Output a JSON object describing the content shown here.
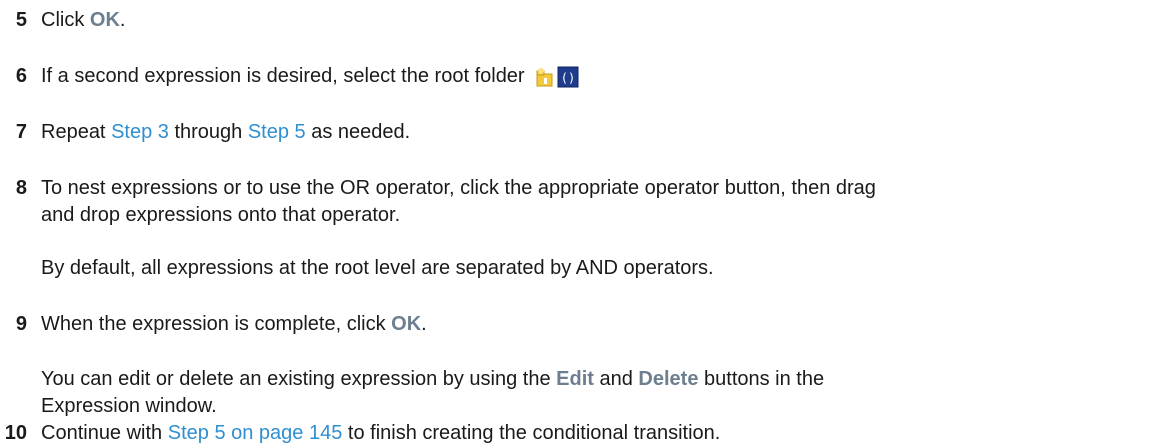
{
  "steps": {
    "s5": {
      "num": "5",
      "pre": "Click ",
      "ui": "OK",
      "post": "."
    },
    "s6": {
      "num": "6",
      "text": "If a second expression is desired, select the root folder"
    },
    "s7": {
      "num": "7",
      "pre": "Repeat ",
      "link1": "Step 3",
      "mid": " through ",
      "link2": "Step 5",
      "post": " as needed."
    },
    "s8": {
      "num": "8",
      "line1": "To nest expressions or to use the OR operator, click the appropriate operator button, then drag",
      "line2": "and drop expressions onto that operator.",
      "note": "By default, all expressions at the root level are separated by AND operators."
    },
    "s9": {
      "num": "9",
      "pre": "When the expression is complete, click ",
      "ui": "OK",
      "post": ".",
      "note_pre": "You can edit or delete an existing expression by using the ",
      "note_ui1": "Edit",
      "note_mid": " and ",
      "note_ui2": "Delete",
      "note_post": " buttons in the",
      "note_line2": "Expression window."
    },
    "s10": {
      "num": "10",
      "pre": "Continue with ",
      "link": "Step 5 on page 145",
      "post": " to finish creating the conditional transition."
    }
  },
  "icons": [
    "folder-expression-icon",
    "expression-box-icon"
  ],
  "colors": {
    "link": "#2f8fd0",
    "ui_label": "#6d7f8f",
    "text": "#1a1a1a"
  }
}
